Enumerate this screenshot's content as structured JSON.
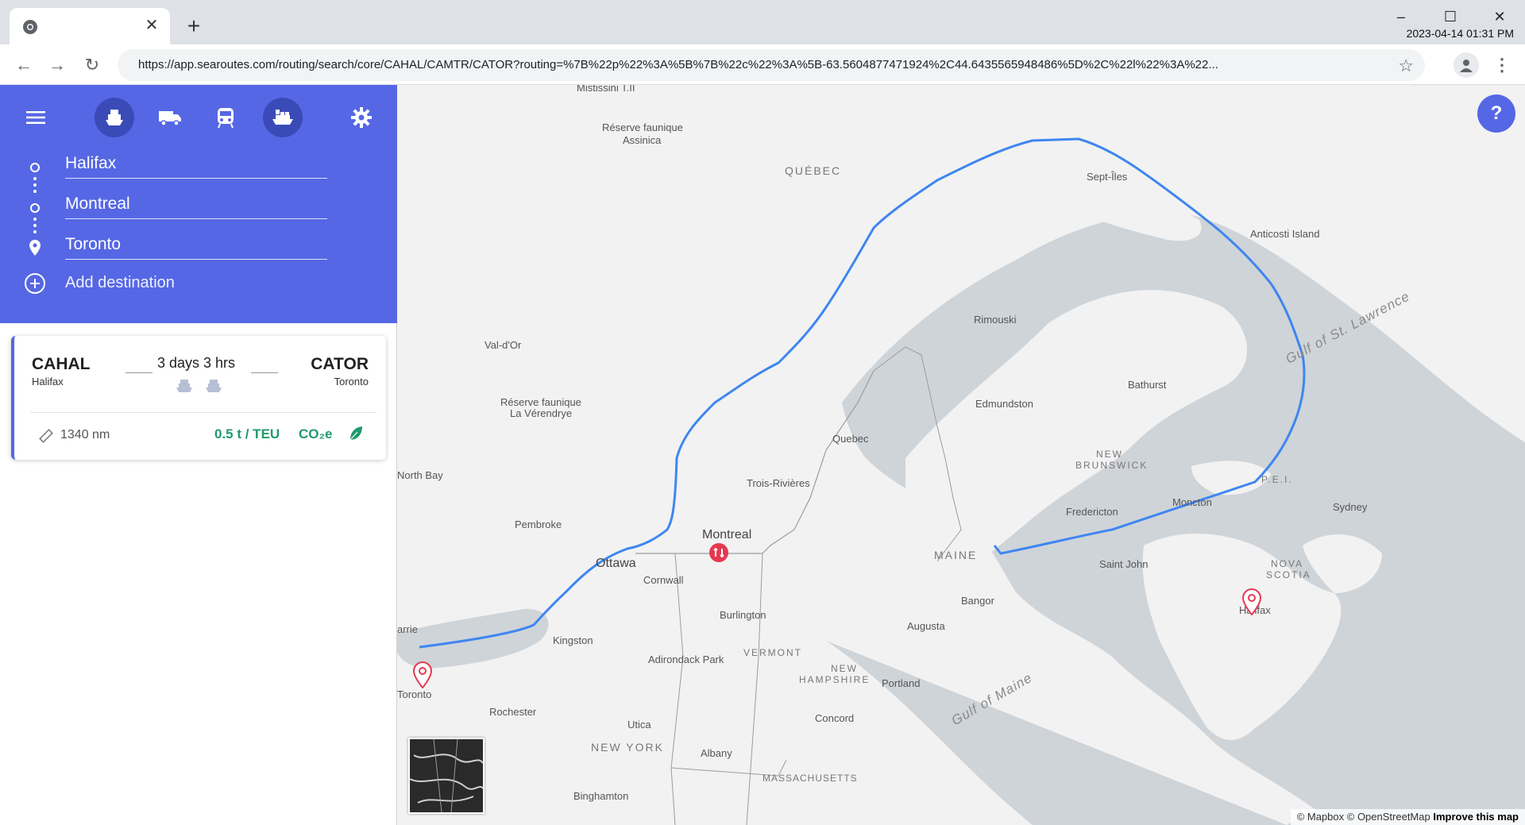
{
  "browser": {
    "tab_close": "✕",
    "new_tab": "+",
    "url": "https://app.searoutes.com/routing/search/core/CAHAL/CAMTR/CATOR?routing=%7B%22p%22%3A%5B%7B%22c%22%3A%5B-63.5604877471924%2C44.6435565948486%5D%2C%22l%22%3A%22...",
    "clock": "2023-04-14 01:31 PM",
    "minimize": "–",
    "maximize": "☐",
    "close": "✕",
    "back": "←",
    "forward": "→",
    "reload": "↻",
    "star": "☆",
    "menu": "⋮"
  },
  "sidebar": {
    "stops": [
      {
        "label": "Halifax"
      },
      {
        "label": "Montreal"
      },
      {
        "label": "Toronto"
      }
    ],
    "add_destination": "Add destination",
    "modes": [
      "menu-icon",
      "ship-icon",
      "truck-icon",
      "train-icon",
      "container-ship-icon",
      "gear-icon"
    ]
  },
  "route_card": {
    "from_code": "CAHAL",
    "from_city": "Halifax",
    "to_code": "CATOR",
    "to_city": "Toronto",
    "duration": "3 days 3 hrs",
    "distance": "1340 nm",
    "emission": "0.5 t / TEU",
    "co2_label": "CO₂e"
  },
  "map": {
    "labels": {
      "mistissini": "Mistissini T.II",
      "reserve_assinica_1": "Réserve faunique",
      "reserve_assinica_2": "Assinica",
      "quebec_region": "QUÉBEC",
      "sept_iles": "Sept-Îles",
      "anticosti": "Anticosti Island",
      "rimouski": "Rimouski",
      "gulf_st_lawrence": "Gulf of St. Lawrence",
      "val_dor": "Val-d'Or",
      "reserve_verendrye_1": "Réserve faunique",
      "reserve_verendrye_2": "La Vérendrye",
      "bathurst": "Bathurst",
      "edmundston": "Edmundston",
      "quebec_city": "Quebec",
      "new_brunswick_1": "NEW",
      "new_brunswick_2": "BRUNSWICK",
      "pei": "P.E.I.",
      "north_bay": "North Bay",
      "trois_rivieres": "Trois-Rivières",
      "moncton": "Moncton",
      "sydney": "Sydney",
      "fredericton": "Fredericton",
      "pembroke": "Pembroke",
      "montreal": "Montreal",
      "ottawa": "Ottawa",
      "maine": "MAINE",
      "saint_john": "Saint John",
      "nova_scotia_1": "NOVA",
      "nova_scotia_2": "SCOTIA",
      "cornwall": "Cornwall",
      "barrie": "arrie",
      "burlington": "Burlington",
      "bangor": "Bangor",
      "halifax": "Halifax",
      "augusta": "Augusta",
      "kingston": "Kingston",
      "vermont": "VERMONT",
      "adirondack": "Adirondack Park",
      "new_hampshire_1": "NEW",
      "new_hampshire_2": "HAMPSHIRE",
      "portland": "Portland",
      "gulf_maine": "Gulf of Maine",
      "toronto": "Toronto",
      "rochester": "Rochester",
      "concord": "Concord",
      "utica": "Utica",
      "new_york": "NEW YORK",
      "albany": "Albany",
      "massachusetts": "MASSACHUSETTS",
      "binghamton": "Binghamton"
    },
    "help": "?",
    "attribution": "© Mapbox © OpenStreetMap",
    "improve": "Improve this map"
  },
  "colors": {
    "accent": "#5567e4",
    "route": "#3f86f0",
    "marker": "#e53950",
    "green": "#1e9a6b"
  }
}
